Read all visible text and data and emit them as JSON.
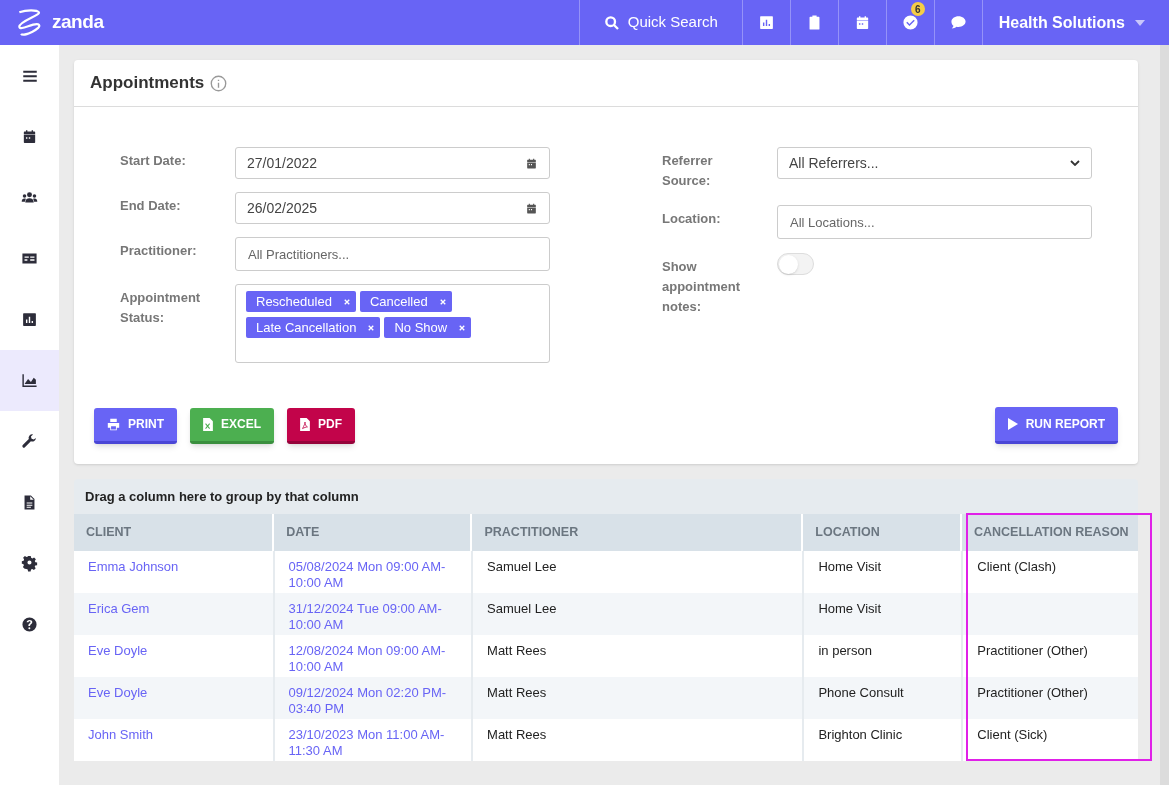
{
  "topbar": {
    "logo": "zanda",
    "search": "Quick Search",
    "icons": [
      {
        "kind": "chart"
      },
      {
        "kind": "clipboard"
      },
      {
        "kind": "calendar"
      },
      {
        "kind": "check",
        "badge": "6"
      },
      {
        "kind": "chat"
      }
    ],
    "account": "Health Solutions"
  },
  "sidebar": {
    "items": [
      {
        "kind": "menu",
        "selected": false
      },
      {
        "kind": "calendar",
        "selected": false
      },
      {
        "kind": "users",
        "selected": false
      },
      {
        "kind": "card",
        "selected": false
      },
      {
        "kind": "chart",
        "selected": false
      },
      {
        "kind": "area",
        "selected": true
      },
      {
        "kind": "wrench",
        "selected": false
      },
      {
        "kind": "file",
        "selected": false
      },
      {
        "kind": "gear",
        "selected": false
      },
      {
        "kind": "help",
        "selected": false
      }
    ]
  },
  "page": {
    "title": "Appointments"
  },
  "filters_left": [
    {
      "kind": "date",
      "label": "Start Date:",
      "value": "27/01/2022"
    },
    {
      "kind": "date",
      "label": "End Date:",
      "value": "26/02/2025"
    },
    {
      "kind": "text",
      "label": "Practitioner:",
      "placeholder": "All Practitioners..."
    },
    {
      "kind": "tags",
      "label": "Appointment Status:",
      "tags": [
        "Rescheduled",
        "Cancelled",
        "Late Cancellation",
        "No Show"
      ]
    }
  ],
  "filters_right": [
    {
      "kind": "select",
      "label": "Referrer Source:",
      "value": "All Referrers..."
    },
    {
      "kind": "text",
      "label": "Location:",
      "placeholder": "All Locations..."
    },
    {
      "kind": "toggle",
      "label": "Show appointment notes:",
      "on": false
    }
  ],
  "actions": [
    {
      "kind": "print",
      "label": "PRINT"
    },
    {
      "kind": "excel",
      "label": "EXCEL"
    },
    {
      "kind": "pdf",
      "label": "PDF"
    }
  ],
  "run_button": "RUN REPORT",
  "table": {
    "group_hint": "Drag a column here to group by that column",
    "columns": [
      {
        "label": "CLIENT",
        "highlighted": false
      },
      {
        "label": "DATE",
        "highlighted": false
      },
      {
        "label": "PRACTITIONER",
        "highlighted": false
      },
      {
        "label": "LOCATION",
        "highlighted": false
      },
      {
        "label": "CANCELLATION REASON",
        "highlighted": true
      }
    ],
    "rows": [
      [
        "Emma Johnson",
        "05/08/2024 Mon 09:00 AM-10:00 AM",
        "Samuel Lee",
        "Home Visit",
        "Client (Clash)"
      ],
      [
        "Erica Gem",
        "31/12/2024 Tue 09:00 AM-10:00 AM",
        "Samuel Lee",
        "Home Visit",
        ""
      ],
      [
        "Eve Doyle",
        "12/08/2024 Mon 09:00 AM-10:00 AM",
        "Matt Rees",
        "in person",
        "Practitioner (Other)"
      ],
      [
        "Eve Doyle",
        "09/12/2024 Mon 02:20 PM-03:40 PM",
        "Matt Rees",
        "Phone Consult",
        "Practitioner (Other)"
      ],
      [
        "John Smith",
        "23/10/2023 Mon 11:00 AM-11:30 AM",
        "Matt Rees",
        "Brighton Clinic",
        "Client (Sick)"
      ]
    ]
  }
}
